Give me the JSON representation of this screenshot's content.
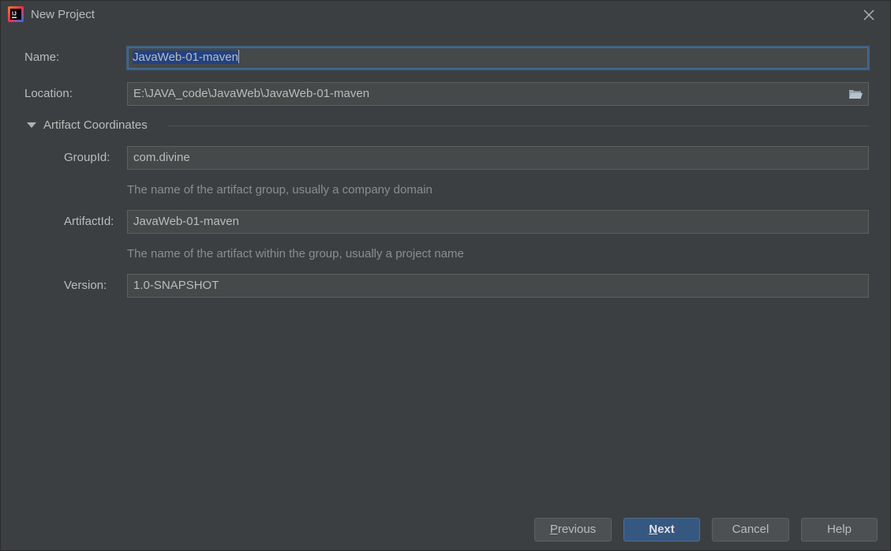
{
  "window": {
    "title": "New Project"
  },
  "form": {
    "name": {
      "label": "Name:",
      "value": "JavaWeb-01-maven"
    },
    "location": {
      "label": "Location:",
      "value": "E:\\JAVA_code\\JavaWeb\\JavaWeb-01-maven"
    },
    "artifact_section": {
      "title": "Artifact Coordinates",
      "expanded": true,
      "group_id": {
        "label": "GroupId:",
        "value": "com.divine",
        "hint": "The name of the artifact group, usually a company domain"
      },
      "artifact_id": {
        "label": "ArtifactId:",
        "value": "JavaWeb-01-maven",
        "hint": "The name of the artifact within the group, usually a project name"
      },
      "version": {
        "label": "Version:",
        "value": "1.0-SNAPSHOT"
      }
    }
  },
  "buttons": {
    "previous_first": "P",
    "previous_rest": "revious",
    "next_first": "N",
    "next_rest": "ext",
    "cancel": "Cancel",
    "help": "Help"
  },
  "icons": {
    "app": "intellij-idea-icon",
    "close": "close-icon",
    "folder": "folder-icon",
    "collapse": "triangle-down-icon"
  },
  "colors": {
    "background": "#3c3f41",
    "field_bg": "#45494a",
    "field_border": "#5e6060",
    "focus_border": "#3d6185",
    "selection": "#214283",
    "primary_button": "#365880",
    "text": "#bbbbbb",
    "hint_text": "#8c8c8c"
  }
}
